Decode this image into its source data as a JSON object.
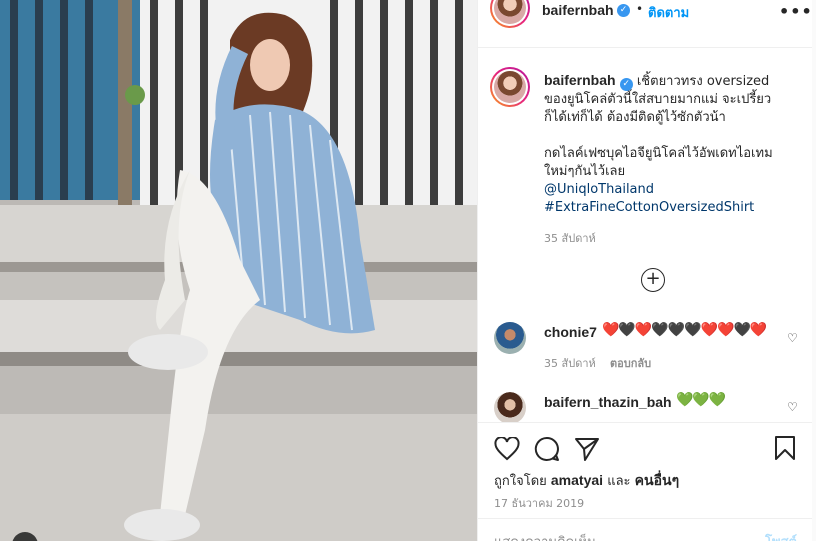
{
  "header": {
    "username": "baifernbah",
    "separator": "•",
    "follow_label": "ติดตาม",
    "more_label": "•••"
  },
  "caption": {
    "username": "baifernbah",
    "line1": "เชิ้ตยาวทรง oversized ของยูนิโคล่ตัวนี้ใส่สบายมากแม่ จะเปรี้ยวก็ได้เท่ก็ได้ ต้องมีติดตู้ไว้ซักตัวน้า",
    "line2": "กดไลค์เฟซบุคไอจียูนิโคล่ไว้อัพเดทไอเทมใหม่ๆกันไว้เลย",
    "mention": "@UniqloThailand",
    "hashtag": "#ExtraFineCottonOversizedShirt",
    "time": "35 สัปดาห์"
  },
  "load_more_label": "+",
  "comments": [
    {
      "username": "chonie7",
      "emoji": "❤️🖤❤️🖤🖤🖤❤️❤️🖤❤️",
      "time": "35 สัปดาห์",
      "reply_label": "ตอบกลับ"
    },
    {
      "username": "baifern_thazin_bah",
      "emoji": "💚💚💚"
    }
  ],
  "icons": {
    "like": "heart-icon",
    "comment": "comment-icon",
    "share": "share-icon",
    "save": "bookmark-icon",
    "more": "more-options-icon",
    "verified": "verified-badge-icon"
  },
  "likes": {
    "prefix": "ถูกใจโดย",
    "user": "amatyai",
    "middle": "และ",
    "others": "คนอื่นๆ"
  },
  "post_date": "17 ธันวาคม 2019",
  "comment_input": {
    "placeholder": "แสดงความคิดเห็น...",
    "post_label": "โพสต์"
  },
  "colors": {
    "accent": "#0095f6",
    "verified": "#3897f0",
    "muted": "#8e8e8e",
    "link": "#00376b",
    "border": "#efefef"
  }
}
